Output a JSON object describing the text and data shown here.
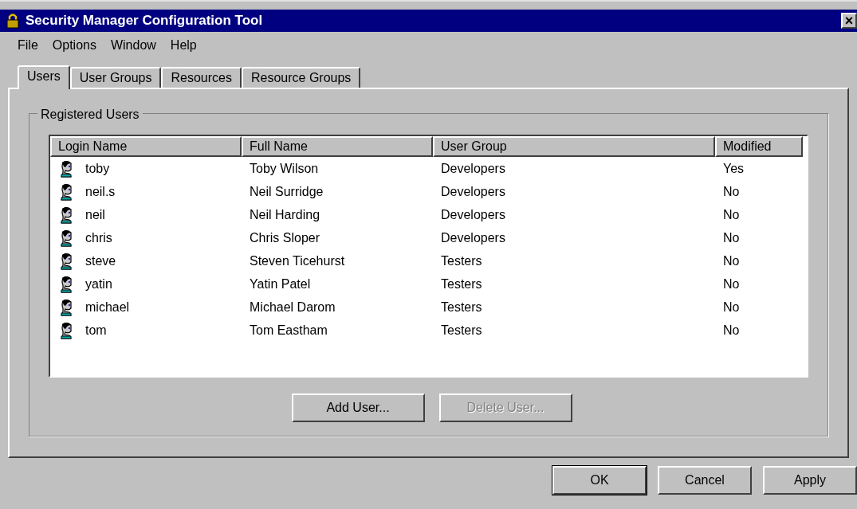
{
  "window": {
    "title": "Security Manager Configuration Tool",
    "close": "×"
  },
  "menu": [
    "File",
    "Options",
    "Window",
    "Help"
  ],
  "tabs": [
    {
      "label": "Users",
      "selected": true
    },
    {
      "label": "User Groups",
      "selected": false
    },
    {
      "label": "Resources",
      "selected": false
    },
    {
      "label": "Resource Groups",
      "selected": false
    }
  ],
  "group": {
    "title": "Registered Users",
    "columns": [
      "Login Name",
      "Full Name",
      "User Group",
      "Modified"
    ],
    "rows": [
      {
        "login": "toby",
        "full": "Toby Wilson",
        "group": "Developers",
        "modified": "Yes"
      },
      {
        "login": "neil.s",
        "full": "Neil Surridge",
        "group": "Developers",
        "modified": "No"
      },
      {
        "login": "neil",
        "full": "Neil Harding",
        "group": "Developers",
        "modified": "No"
      },
      {
        "login": "chris",
        "full": "Chris Sloper",
        "group": "Developers",
        "modified": "No"
      },
      {
        "login": "steve",
        "full": "Steven Ticehurst",
        "group": "Testers",
        "modified": "No"
      },
      {
        "login": "yatin",
        "full": "Yatin Patel",
        "group": "Testers",
        "modified": "No"
      },
      {
        "login": "michael",
        "full": "Michael Darom",
        "group": "Testers",
        "modified": "No"
      },
      {
        "login": "tom",
        "full": "Tom Eastham",
        "group": "Testers",
        "modified": "No"
      }
    ],
    "buttons": [
      {
        "label": "Add User...",
        "disabled": false
      },
      {
        "label": "Delete User...",
        "disabled": true
      }
    ]
  },
  "buttons": [
    {
      "label": "OK",
      "default": true
    },
    {
      "label": "Cancel",
      "default": false
    },
    {
      "label": "Apply",
      "default": false
    }
  ]
}
